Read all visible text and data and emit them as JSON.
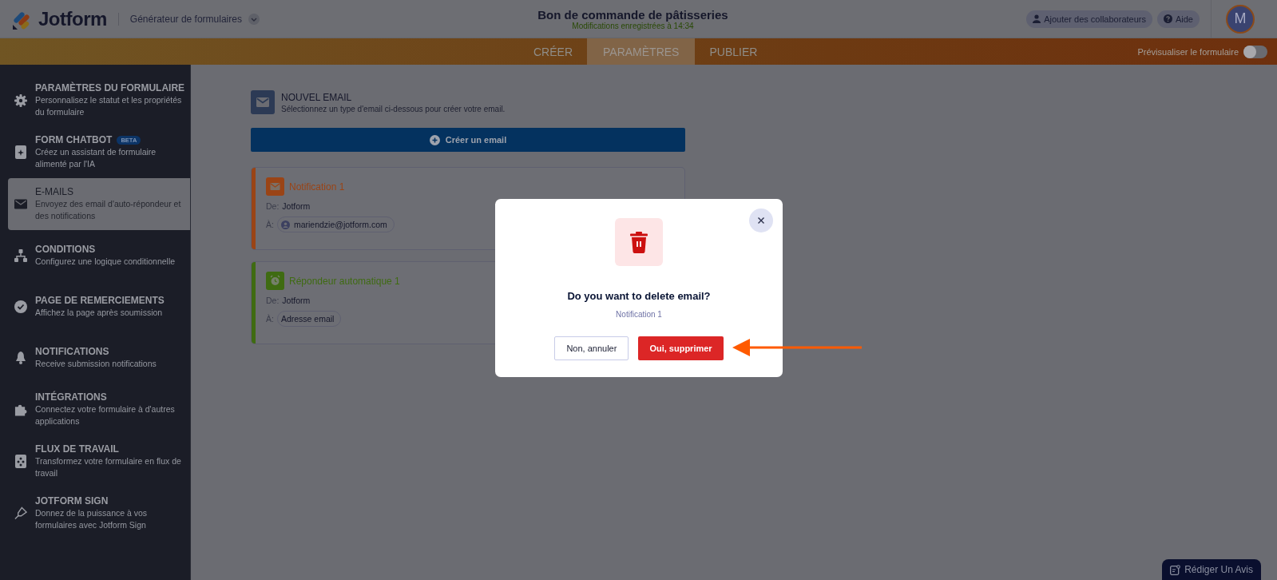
{
  "header": {
    "logo": "Jotform",
    "product": "Générateur de formulaires",
    "form_title": "Bon de commande de pâtisseries",
    "save_status": "Modifications enregistrées à 14:34",
    "collaborators_button": "Ajouter des collaborateurs",
    "help_button": "Aide",
    "avatar": "M"
  },
  "tabs": [
    {
      "label": "CRÉER",
      "selected": false
    },
    {
      "label": "PARAMÈTRES",
      "selected": true
    },
    {
      "label": "PUBLIER",
      "selected": false
    }
  ],
  "preview": {
    "label": "Prévisualiser le formulaire",
    "on": false
  },
  "sidebar": {
    "items": [
      {
        "title": "PARAMÈTRES DU FORMULAIRE",
        "description": "Personnalisez le statut et les propriétés du formulaire",
        "selected": false
      },
      {
        "title": "FORM CHATBOT",
        "badge": "BETA",
        "description": "Créez un assistant de formulaire alimenté par l'IA",
        "selected": false
      },
      {
        "title": "E-MAILS",
        "description": "Envoyez des email d'auto-répondeur et des notifications",
        "selected": true
      },
      {
        "title": "CONDITIONS",
        "description": "Configurez une logique conditionnelle",
        "selected": false
      },
      {
        "title": "PAGE DE REMERCIEMENTS",
        "description": "Affichez la page après soumission",
        "selected": false
      },
      {
        "title": "NOTIFICATIONS",
        "description": "Receive submission notifications",
        "selected": false
      },
      {
        "title": "INTÉGRATIONS",
        "description": "Connectez votre formulaire à d'autres applications",
        "selected": false
      },
      {
        "title": "FLUX DE TRAVAIL",
        "description": "Transformez votre formulaire en flux de travail",
        "selected": false
      },
      {
        "title": "JOTFORM SIGN",
        "description": "Donnez de la puissance à vos formulaires avec Jotform Sign",
        "selected": false
      }
    ]
  },
  "new_email": {
    "title": "NOUVEL EMAIL",
    "subtitle": "Sélectionnez un type d'email ci-dessous pour créer votre email.",
    "create_button": "Créer un email"
  },
  "emails": [
    {
      "kind": "notification",
      "name": "Notification 1",
      "color": "#9a4416",
      "from_label": "De:",
      "from": "Jotform",
      "to_label": "À:",
      "to": "mariendzie@jotform.com"
    },
    {
      "kind": "autoresponder",
      "name": "Répondeur automatique 1",
      "color": "#3f6b12",
      "from_label": "De:",
      "from": "Jotform",
      "to_label": "À:",
      "to": "Adresse email"
    }
  ],
  "dialog": {
    "title": "Do you want to delete email?",
    "subtitle": "Notification 1",
    "cancel_button": "Non, annuler",
    "confirm_button": "Oui, supprimer"
  },
  "feedback_button": "Rédiger Un Avis"
}
